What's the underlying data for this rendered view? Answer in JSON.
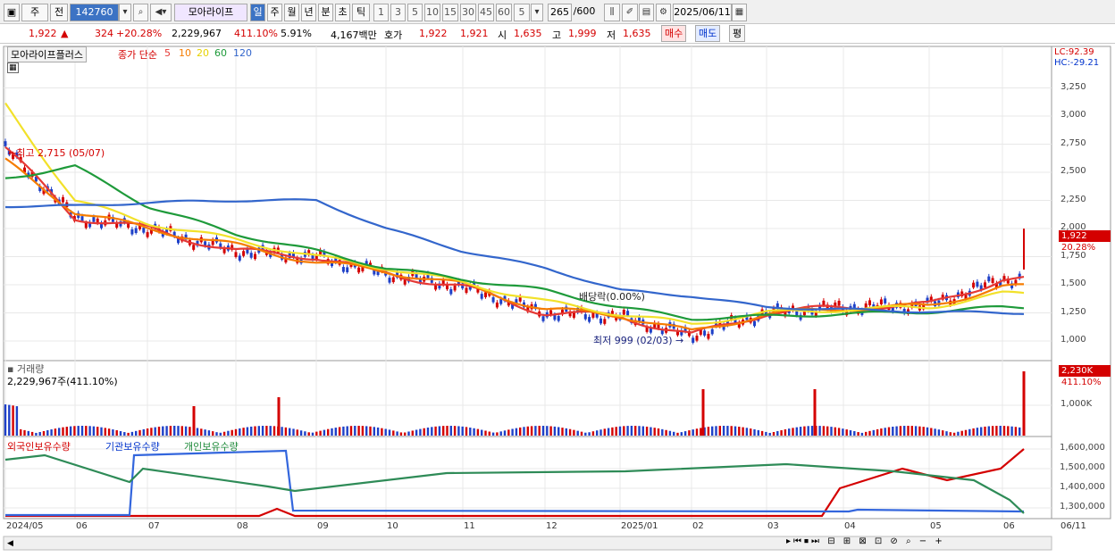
{
  "toolbar": {
    "mode": "주",
    "type": "전",
    "code": "142760",
    "name": "모아라이프",
    "period_tabs": [
      "일",
      "주",
      "월",
      "년",
      "분",
      "초",
      "틱"
    ],
    "active_tab": "일",
    "intervals": [
      "1",
      "3",
      "5",
      "10",
      "15",
      "30",
      "45",
      "60"
    ],
    "interval_sel": "5",
    "count": "265",
    "count_max": "/600",
    "date": "2025/06/11"
  },
  "quote": {
    "price": "1,922",
    "change": "324",
    "change_rate": "+20.28%",
    "volume": "2,229,967",
    "vol_rate": "411.10%",
    "turnover": "5.91%",
    "amount": "4,167백만",
    "bid_label": "호가",
    "ask": "1,922",
    "bid": "1,921",
    "open_label": "시",
    "open": "1,635",
    "high_label": "고",
    "high": "1,999",
    "low_label": "저",
    "low": "1,635",
    "buy_btn": "매수",
    "sell_btn": "매도",
    "eval_btn": "평"
  },
  "legend": {
    "name": "모아라이프플러스",
    "ma_title": "종가 단순",
    "ma": [
      {
        "p": "5",
        "c": "#e53935"
      },
      {
        "p": "10",
        "c": "#f57c00"
      },
      {
        "p": "20",
        "c": "#f2e12a"
      },
      {
        "p": "60",
        "c": "#1e9a3a"
      },
      {
        "p": "120",
        "c": "#3366cc"
      }
    ]
  },
  "right_info": {
    "lc": "LC:92.39",
    "hc": "HC:-29.21",
    "last_price": "1,922",
    "last_rate": "20.28%",
    "vol_last": "2,230K",
    "vol_rate": "411.10%"
  },
  "annotations": {
    "high": "최고 2,715 (05/07)",
    "low": "최저 999 (02/03)",
    "dividend": "배당락(0.00%)"
  },
  "volume_panel": {
    "title": "거래량",
    "info": "2,229,967주(411.10%)"
  },
  "holding_panel": {
    "series": [
      "외국인보유수량",
      "기관보유수량",
      "개인보유수량"
    ]
  },
  "price_axis": [
    "3,250",
    "3,000",
    "2,750",
    "2,500",
    "2,250",
    "2,000",
    "1,750",
    "1,500",
    "1,250",
    "1,000"
  ],
  "vol_axis": [
    "1,000K"
  ],
  "hold_axis": [
    "1,600,000",
    "1,500,000",
    "1,400,000",
    "1,300,000"
  ],
  "x_axis": [
    "2024/05",
    "06",
    "07",
    "08",
    "09",
    "10",
    "11",
    "12",
    "2025/01",
    "02",
    "03",
    "04",
    "05",
    "06",
    "06/11"
  ],
  "chart_data": {
    "type": "line",
    "x": [
      "2024/05",
      "06",
      "07",
      "08",
      "09",
      "10",
      "11",
      "12",
      "2025/01",
      "02",
      "03",
      "04",
      "05",
      "06"
    ],
    "series": [
      {
        "name": "5",
        "values": [
          2715,
          2100,
          2000,
          1800,
          1750,
          1600,
          1480,
          1250,
          1220,
          1050,
          1250,
          1300,
          1320,
          1550
        ]
      },
      {
        "name": "10",
        "values": [
          2600,
          2150,
          2000,
          1850,
          1700,
          1620,
          1500,
          1280,
          1230,
          1080,
          1240,
          1290,
          1310,
          1480
        ]
      },
      {
        "name": "20",
        "values": [
          3100,
          2250,
          2050,
          1900,
          1750,
          1650,
          1520,
          1350,
          1240,
          1150,
          1250,
          1280,
          1300,
          1420
        ]
      },
      {
        "name": "60",
        "values": [
          2450,
          2550,
          2200,
          1950,
          1800,
          1650,
          1550,
          1450,
          1300,
          1200,
          1220,
          1240,
          1260,
          1300
        ]
      },
      {
        "name": "120",
        "values": [
          2200,
          2200,
          2230,
          2250,
          2250,
          2000,
          1800,
          1650,
          1450,
          1400,
          1300,
          1280,
          1260,
          1250
        ]
      }
    ],
    "low": 999,
    "high": 2715
  }
}
